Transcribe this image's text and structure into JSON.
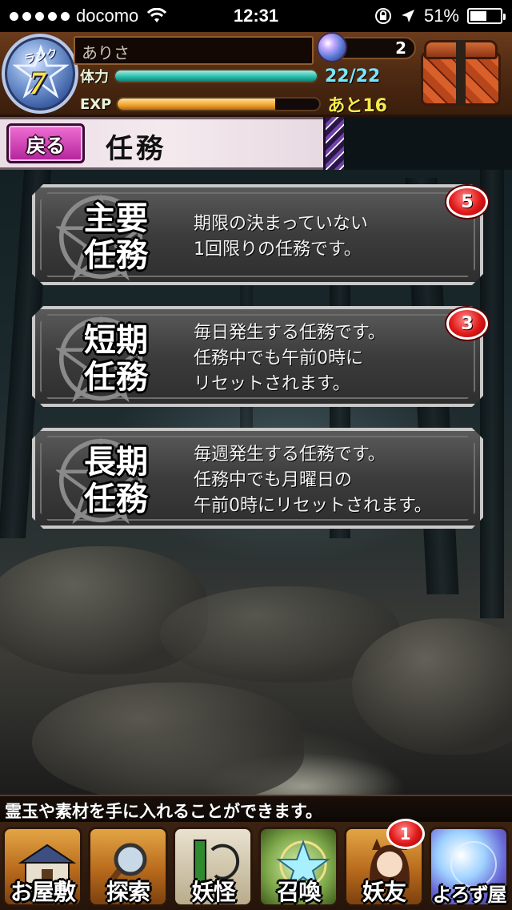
{
  "status_bar": {
    "carrier": "docomo",
    "time": "12:31",
    "battery": "51%"
  },
  "header": {
    "rank_label": "ランク",
    "rank": "7",
    "player_name": "ありさ",
    "stamina_label": "体力",
    "stamina_value": "22/22",
    "stamina_fraction": 1.0,
    "exp_label": "EXP",
    "exp_value": "あと16",
    "exp_fraction": 0.78,
    "orb_count": "2"
  },
  "title_bar": {
    "back_label": "戻る",
    "title": "任務"
  },
  "missions": [
    {
      "title": "主要\n任務",
      "description": "期限の決まっていない\n1回限りの任務です。",
      "badge": "5"
    },
    {
      "title": "短期\n任務",
      "description": "毎日発生する任務です。\n任務中でも午前0時に\nリセットされます。",
      "badge": "3"
    },
    {
      "title": "長期\n任務",
      "description": "毎週発生する任務です。\n任務中でも月曜日の\n午前0時にリセットされます。",
      "badge": ""
    }
  ],
  "ticker": "霊玉や素材を手に入れることができます。",
  "bottom_nav": [
    {
      "label": "お屋敷",
      "icon": "mansion-icon",
      "badge": ""
    },
    {
      "label": "探索",
      "icon": "magnifier-icon",
      "badge": ""
    },
    {
      "label": "妖怪",
      "icon": "scroll-icon",
      "badge": ""
    },
    {
      "label": "召喚",
      "icon": "pentagram-icon",
      "badge": ""
    },
    {
      "label": "妖友",
      "icon": "friend-icon",
      "badge": "1"
    },
    {
      "label": "よろず屋",
      "icon": "orb-shop-icon",
      "badge": ""
    }
  ],
  "colors": {
    "stamina_bar": "#22b7a7",
    "exp_bar": "#f0a22c",
    "back_button": "#d84bbd",
    "badge": "#e01818"
  }
}
